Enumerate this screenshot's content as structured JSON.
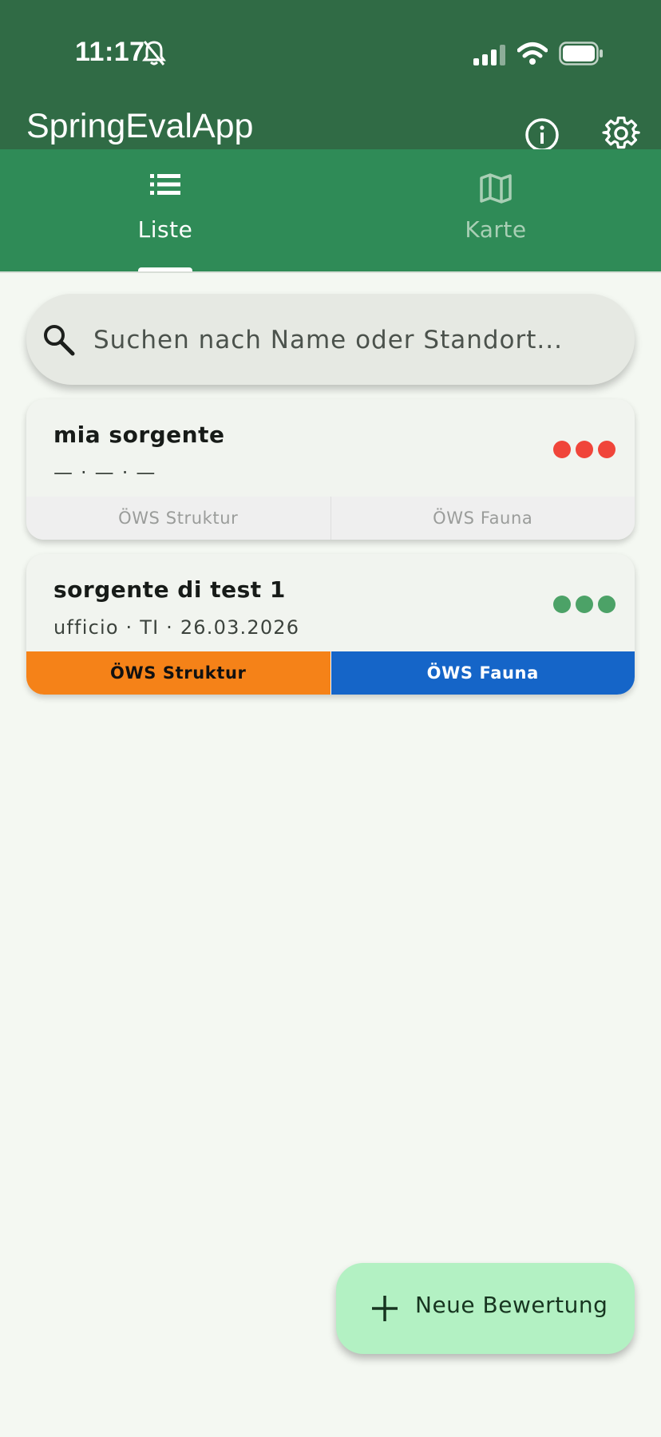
{
  "status_bar": {
    "time": "11:17"
  },
  "app_bar": {
    "title": "SpringEvalApp"
  },
  "tabs": [
    {
      "label": "Liste",
      "icon": "list-icon",
      "selected": true
    },
    {
      "label": "Karte",
      "icon": "map-icon",
      "selected": false
    }
  ],
  "search": {
    "placeholder": "Suchen nach Name oder Standort..."
  },
  "entries": [
    {
      "name": "mia sorgente",
      "subtitle": "— · — · —",
      "status_dots_color": "#f0453a",
      "actions": [
        "ÖWS Struktur",
        "ÖWS Fauna"
      ],
      "action_colors": [
        "#efefef",
        "#efefef"
      ]
    },
    {
      "name": "sorgente di test 1",
      "subtitle": "ufficio · TI · 26.03.2026",
      "status_dots_color": "#4ca267",
      "actions": [
        "ÖWS Struktur",
        "ÖWS Fauna"
      ],
      "action_colors": [
        "#f58218",
        "#1565c8"
      ]
    }
  ],
  "fab": {
    "label": "Neue Bewertung"
  },
  "colors": {
    "status_bar": "#306b45",
    "tab_bar": "#2f8b57",
    "background": "#f4f8f2",
    "fab": "#b3f1c3"
  }
}
